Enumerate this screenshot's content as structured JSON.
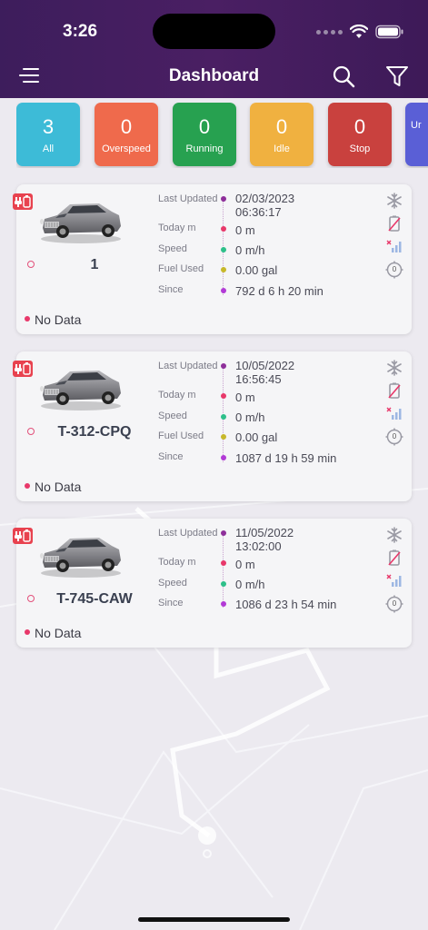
{
  "status_bar": {
    "time": "3:26"
  },
  "header": {
    "title": "Dashboard"
  },
  "tiles": [
    {
      "count": "3",
      "label": "All",
      "color": "#3dbbd7"
    },
    {
      "count": "0",
      "label": "Overspeed",
      "color": "#ef6a4c"
    },
    {
      "count": "0",
      "label": "Running",
      "color": "#27a150"
    },
    {
      "count": "0",
      "label": "Idle",
      "color": "#f0b140"
    },
    {
      "count": "0",
      "label": "Stop",
      "color": "#c9413e"
    },
    {
      "count": "",
      "label": "Ur",
      "color": "#5a5fd6"
    }
  ],
  "labels": {
    "last_updated": "Last Updated",
    "today": "Today m",
    "speed": "Speed",
    "fuel_used": "Fuel Used",
    "since": "Since",
    "no_data": "No Data"
  },
  "vehicles": [
    {
      "plate": "1",
      "last_updated_date": "02/03/2023",
      "last_updated_time": "06:36:17",
      "today": "0 m",
      "speed": "0 m/h",
      "fuel_used": "0.00 gal",
      "since": "792 d 6 h 20 min",
      "odometer": "0"
    },
    {
      "plate": "T-312-CPQ",
      "last_updated_date": "10/05/2022",
      "last_updated_time": "16:56:45",
      "today": "0 m",
      "speed": "0 m/h",
      "fuel_used": "0.00 gal",
      "since": "1087 d 19 h 59 min",
      "odometer": "0"
    },
    {
      "plate": "T-745-CAW",
      "last_updated_date": "11/05/2022",
      "last_updated_time": "13:02:00",
      "today": "0 m",
      "speed": "0 m/h",
      "since": "1086 d 23 h 54 min",
      "odometer": "0"
    }
  ],
  "colors": {
    "header_bg": "#4a1f63",
    "dot_last_updated": "#8e2f9a",
    "dot_today": "#e8386a",
    "dot_speed": "#2ec08a",
    "dot_fuel": "#c7b82a",
    "dot_since": "#b23ad6",
    "no_data_dot": "#e8386a"
  },
  "icons": [
    "menu-icon",
    "search-icon",
    "filter-icon",
    "plug-icon",
    "car-image",
    "snowflake-icon",
    "battery-off-icon",
    "signal-off-icon",
    "odometer-icon",
    "wifi-icon",
    "battery-icon"
  ]
}
